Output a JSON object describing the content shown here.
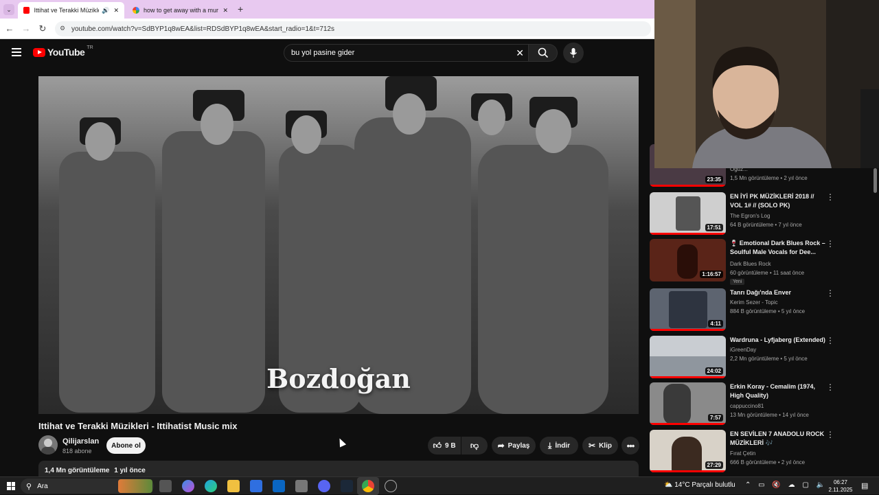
{
  "browser": {
    "tabs": [
      {
        "label": "Ittihat ve Terakki Müzikleri",
        "active": true
      },
      {
        "label": "how to get away with a murder",
        "active": false
      }
    ],
    "new_tab_label": "+",
    "url": "youtube.com/watch?v=SdBYP1q8wEA&list=RDSdBYP1q8wEA&start_radio=1&t=712s"
  },
  "youtube": {
    "logo_text": "YouTube",
    "region": "TR",
    "search_query": "bu yol pasine gider",
    "video": {
      "overlay_text": "Bozdoğan",
      "title": "Ittihat ve Terakki Müzikleri - Ittihatist Music mix",
      "channel": "Qilijarslan",
      "subscribers": "818 abone",
      "subscribe_label": "Abone ol",
      "likes": "9 B",
      "share_label": "Paylaş",
      "download_label": "İndir",
      "clip_label": "Klip",
      "views": "1,4 Mn görüntüleme",
      "age": "1 yıl önce"
    },
    "recommendations": [
      {
        "title": "",
        "channel": "Oguz...",
        "meta": "1,5 Mn görüntüleme • 2 yıl önce",
        "duration": "23:35",
        "thumb_color": "#4a3a44",
        "new": ""
      },
      {
        "title": "EN İYİ PK MÜZİKLERİ 2018 // VOL 1# // (SOLO PK)",
        "channel": "The Egron's Log",
        "meta": "64 B görüntüleme • 7 yıl önce",
        "duration": "17:51",
        "thumb_color": "#cfcfcf",
        "new": ""
      },
      {
        "title": "🍷 Emotional Dark Blues Rock – Soulful Male Vocals for Dee...",
        "channel": "Dark Blues Rock",
        "meta": "60 görüntüleme • 11 saat önce",
        "duration": "1:16:57",
        "thumb_color": "#5a2418",
        "new": "Yeni"
      },
      {
        "title": "Tanrı Dağı'nda Enver",
        "channel": "Kerim Sezer - Topic",
        "meta": "884 B görüntüleme • 5 yıl önce",
        "duration": "4:11",
        "thumb_color": "#5d6470",
        "new": ""
      },
      {
        "title": "Wardruna - Lyfjaberg (Extended)",
        "channel": "iGreenDay",
        "meta": "2,2 Mn görüntüleme • 5 yıl önce",
        "duration": "24:02",
        "thumb_color": "#c9cdd2",
        "new": ""
      },
      {
        "title": "Erkin Koray - Cemalim (1974, High Quality)",
        "channel": "cappuccino81",
        "meta": "13 Mn görüntüleme • 14 yıl önce",
        "duration": "7:57",
        "thumb_color": "#8a8a8a",
        "new": ""
      },
      {
        "title": "EN SEVİLEN 7 ANADOLU ROCK MÜZİKLERİ 🎶",
        "channel": "Fırat Çetin",
        "meta": "666 B görüntüleme • 2 yıl önce",
        "duration": "27:29",
        "thumb_color": "#d8d2c8",
        "new": ""
      }
    ]
  },
  "taskbar": {
    "search_placeholder": "Ara",
    "weather": "14°C  Parçalı bulutlu",
    "time": "06:27",
    "date": "2.11.2025"
  },
  "colors": {
    "yt_red": "#ff0000",
    "yt_bg": "#0f0f0f",
    "chip_bg": "#272727",
    "tab_bar": "#e8c9f0"
  }
}
